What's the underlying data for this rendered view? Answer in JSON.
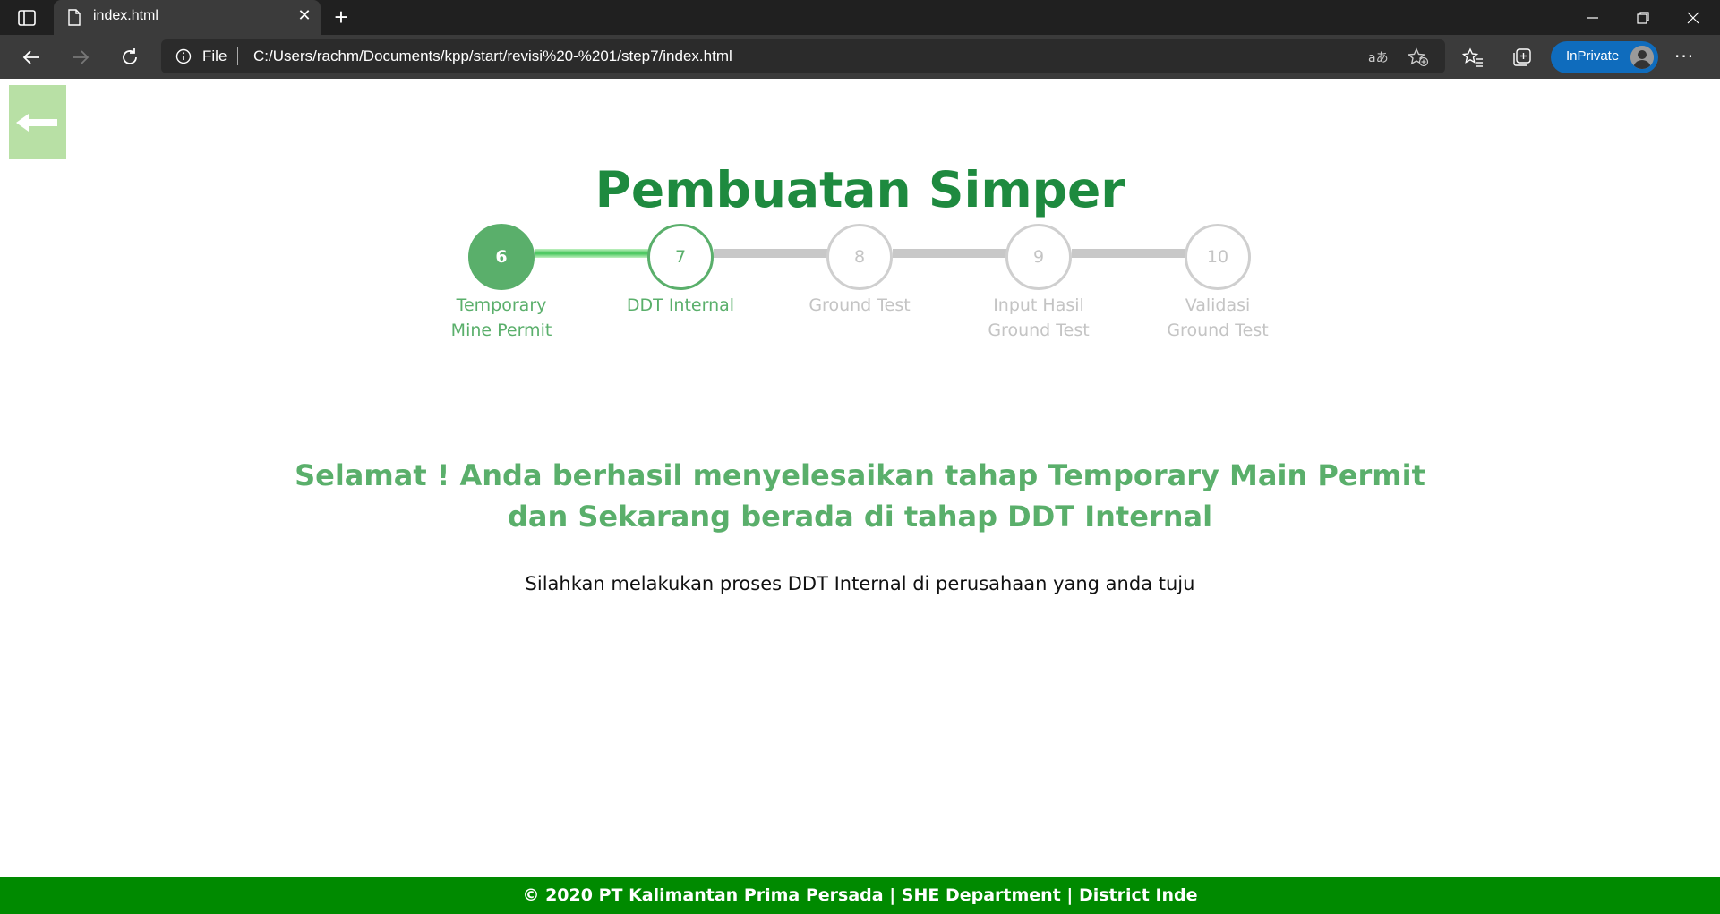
{
  "browser": {
    "tab_title": "index.html",
    "url_scheme": "File",
    "url": "C:/Users/rachm/Documents/kpp/start/revisi%20-%201/step7/index.html",
    "inprivate_label": "InPrivate"
  },
  "page": {
    "title": "Pembuatan Simper",
    "steps": [
      {
        "number": "6",
        "label_line1": "Temporary",
        "label_line2": "Mine Permit",
        "state": "complete"
      },
      {
        "number": "7",
        "label_line1": "DDT Internal",
        "label_line2": "",
        "state": "current"
      },
      {
        "number": "8",
        "label_line1": "Ground Test",
        "label_line2": "",
        "state": "upcoming"
      },
      {
        "number": "9",
        "label_line1": "Input Hasil",
        "label_line2": "Ground Test",
        "state": "upcoming"
      },
      {
        "number": "10",
        "label_line1": "Validasi",
        "label_line2": "Ground Test",
        "state": "upcoming"
      }
    ],
    "congrats_line1": "Selamat ! Anda berhasil menyelesaikan tahap Temporary Main Permit",
    "congrats_line2": "dan Sekarang berada di tahap DDT Internal",
    "instruction": "Silahkan melakukan proses DDT Internal di perusahaan yang anda tuju",
    "footer": "© 2020 PT Kalimantan Prima Persada | SHE Department | District Inde"
  },
  "colors": {
    "accent": "#5aaf6b",
    "title": "#1e8a3f",
    "footer_bg": "#008a00",
    "back_button_bg": "#b8e0a5",
    "inactive": "#c4c4c4"
  },
  "icons": {
    "back_button": "arrow-left-icon",
    "tab": "file-icon",
    "nav": [
      "back-icon",
      "forward-icon",
      "refresh-icon"
    ],
    "url": [
      "info-icon",
      "read-aloud-icon",
      "add-favorite-icon"
    ],
    "toolbar": [
      "favorites-icon",
      "collections-icon",
      "more-icon"
    ]
  }
}
